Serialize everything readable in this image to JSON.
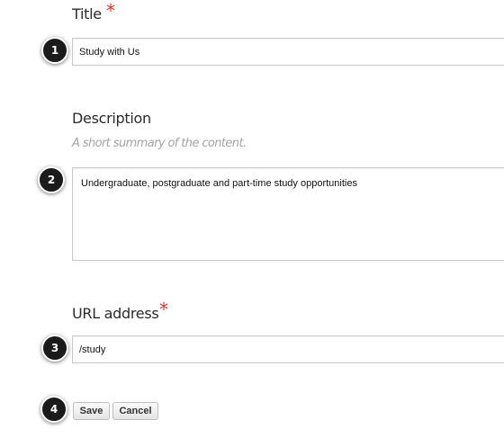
{
  "form": {
    "title": {
      "label": "Title",
      "required_mark": "*",
      "value": "Study with Us"
    },
    "description": {
      "label": "Description",
      "hint": "A short summary of the content.",
      "value": "Undergraduate, postgraduate and part-time study opportunities"
    },
    "url": {
      "label": "URL address",
      "required_mark": "*",
      "value": "/study"
    },
    "actions": {
      "save_label": "Save",
      "cancel_label": "Cancel"
    }
  },
  "markers": [
    "1",
    "2",
    "3",
    "4"
  ],
  "colors": {
    "required": "#d9342b",
    "hint": "#a5a5a5",
    "marker_bg": "#1b1b1b",
    "field_border": "#c9c9c9"
  }
}
